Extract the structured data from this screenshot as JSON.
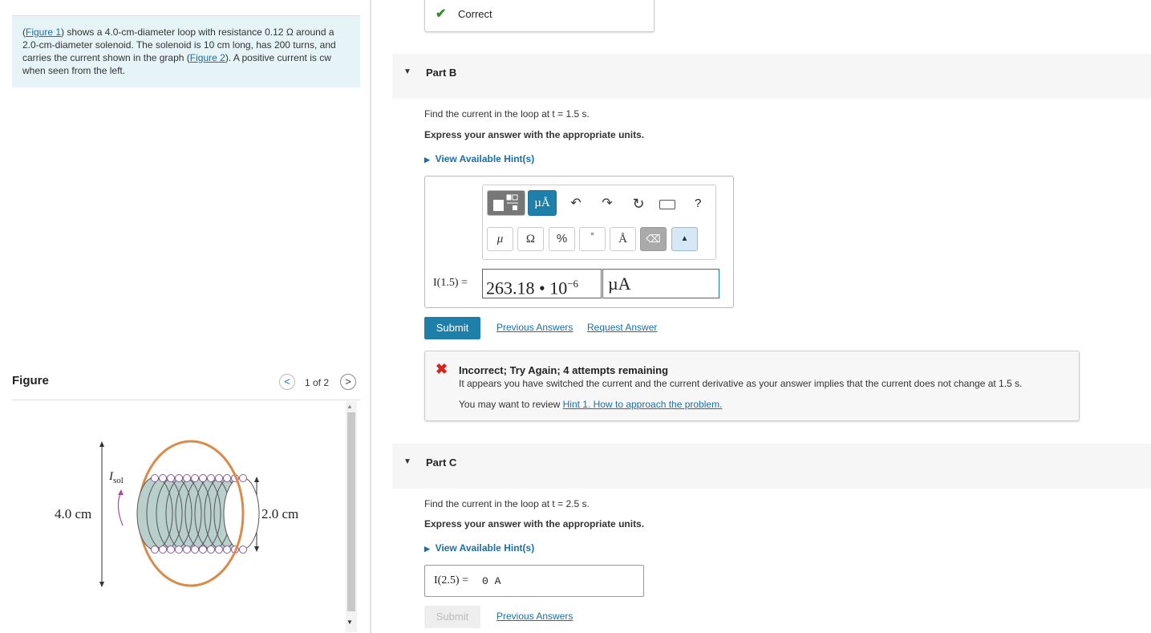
{
  "problem": {
    "figure1_link": "Figure 1",
    "text_part1": ") shows a 4.0-cm-diameter loop with resistance 0.12 Ω around a 2.0-cm-diameter solenoid.  The solenoid is 10 cm long, has 200 turns, and carries the current shown in the graph (",
    "figure2_link": "Figure 2",
    "text_part2": "). A positive current is cw when seen from the left."
  },
  "figure_panel": {
    "title": "Figure",
    "counter": "1 of 2",
    "prev_icon": "<",
    "next_icon": ">",
    "labels": {
      "loop_diameter": "4.0 cm",
      "solenoid_diameter": "2.0 cm",
      "current_I": "I",
      "current_sub": "sol"
    }
  },
  "correct_banner": {
    "text": "Correct",
    "icon": "check-icon",
    "color": "#2e8b2e"
  },
  "part_b": {
    "label": "Part B",
    "question": "Find the current in the loop at t = 1.5 s.",
    "instruction": "Express your answer with the appropriate units.",
    "hint_link": "View Available Hint(s)",
    "toolbar": {
      "row1": [
        "template-icon",
        "µÅ",
        "undo-icon",
        "redo-icon",
        "reset-icon",
        "keyboard-icon",
        "?"
      ],
      "row2": [
        "μ",
        "Ω",
        "%",
        "°",
        "Å",
        "backspace-icon",
        "keyboard-toggle-icon"
      ],
      "units_btn": "µÅ",
      "help": "?",
      "mu": "μ",
      "omega": "Ω",
      "percent": "%",
      "degree": "°",
      "angstrom": "Å"
    },
    "variable_label": "I(1.5) =",
    "answer_value": "263.18 • 10",
    "answer_exponent": "−6",
    "unit_value": "µA",
    "submit_label": "Submit",
    "previous_answers": "Previous Answers",
    "request_answer": "Request Answer",
    "feedback": {
      "title": "Incorrect; Try Again; 4 attempts remaining",
      "message": "It appears you have switched the current and the current derivative as your answer implies that the current does not change at 1.5 s.",
      "review_prefix": "You may want to review ",
      "review_link": "Hint 1. How to approach the problem.",
      "icon": "x-icon",
      "color": "#d0261b"
    }
  },
  "part_c": {
    "label": "Part C",
    "question": "Find the current in the loop at t = 2.5 s.",
    "instruction": "Express your answer with the appropriate units.",
    "hint_link": "View Available Hint(s)",
    "variable_label": "I(2.5) =",
    "answer_value": "0 A",
    "submit_label": "Submit",
    "previous_answers": "Previous Answers"
  }
}
